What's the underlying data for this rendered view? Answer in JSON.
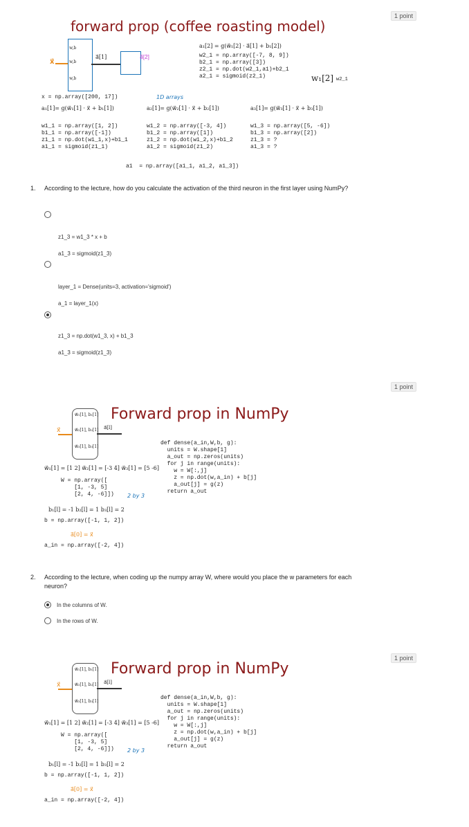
{
  "points": [
    "1 point",
    "1 point",
    "1 point"
  ],
  "slide1": {
    "title": "forward prop (coffee roasting model)",
    "layer2_math": "a₁[2] = g(w⃗₁[2] · a⃗[1] + b₁[2])",
    "layer2_code": [
      "w2_1 = np.array([-7, 8, 9])",
      "b2_1 = np.array([3])",
      "z2_1 = np.dot(w2_1,a1)+b2_1",
      "a2_1 = sigmoid(z2_1)"
    ],
    "w2_label": "w₁[2]",
    "w2_var": "w2_1",
    "x_line": "x = np.array([200, 17])",
    "oned_note": "1D arrays",
    "neuron1_math": "a₁[1]= g(w⃗₁[1] · x⃗ + b₁[1])",
    "neuron2_math": "a₂[1]= g(w⃗₂[1] · x⃗ + b₂[1])",
    "neuron3_math": "a₃[1]= g(w⃗₃[1] · x⃗ + b₃[1])",
    "neuron1_code": [
      "w1_1 = np.array([1, 2])",
      "b1_1 = np.array([-1])",
      "z1_1 = np.dot(w1_1,x)+b1_1",
      "a1_1 = sigmoid(z1_1)"
    ],
    "neuron2_code": [
      "w1_2 = np.array([-3, 4])",
      "b1_2 = np.array([1])",
      "z1_2 = np.dot(w1_2,x)+b1_2",
      "a1_2 = sigmoid(z1_2)"
    ],
    "neuron3_code": [
      "w1_3 = np.array([5, -6])",
      "b1_3 = np.array([2])",
      "z1_3 = ?",
      "a1_3 = ?"
    ],
    "a1_line": "a1  = np.array([a1_1, a1_2, a1_3])",
    "layer1_label": "a⃗[1]",
    "layer2_label": "a⃗[2]",
    "x_input": "x⃗"
  },
  "q1": {
    "number": "1.",
    "text": "According to the lecture, how do you calculate the activation of the third neuron in the first layer using NumPy?",
    "options": [
      {
        "lines": [
          "z1_3 = w1_3 * x + b",
          "a1_3 = sigmoid(z1_3)"
        ],
        "selected": false
      },
      {
        "lines": [
          "layer_1 = Dense(units=3, activation='sigmoid')",
          "a_1 = layer_1(x)"
        ],
        "selected": false
      },
      {
        "lines": [
          "z1_3 = np.dot(w1_3, x) + b1_3",
          "a1_3 = sigmoid(z1_3)"
        ],
        "selected": true
      }
    ]
  },
  "slide2": {
    "title": "Forward prop in NumPy",
    "w_vectors": "w⃗₁[1] = [1 2]   w⃗₂[1] = [-3 4]   w⃗₃[1] = [5 -6]",
    "w_code": [
      "W = np.array([",
      "    [1, -3, 5]",
      "    [2, 4, -6]])"
    ],
    "by_note": "2 by 3",
    "b_math": "b₁[l] = -1   b₂[l] = 1   b₃[l] = 2",
    "b_code": "b = np.array([-1, 1, 2])",
    "a0_math": "a⃗[0] = x⃗",
    "ain_code": "a_in = np.array([-2, 4])",
    "dense_code": [
      "def dense(a_in,W,b, g):",
      "  units = W.shape[1]",
      "  a_out = np.zeros(units)",
      "  for j in range(units):",
      "    w = W[:,j]",
      "    z = np.dot(w,a_in) + b[j]",
      "    a_out[j] = g(z)",
      "  return a_out"
    ],
    "neuron_labels": [
      "w⃗₁[1], b₁[1]",
      "w⃗₂[1], b₂[1]",
      "w⃗₃[1], b₃[1]"
    ],
    "layer_label": "a⃗[l]",
    "x_input": "x⃗"
  },
  "q2": {
    "number": "2.",
    "text": "According to the lecture, when coding up the numpy array W, where would you place the w parameters for each neuron?",
    "options": [
      {
        "label": "In the columns of W.",
        "selected": true
      },
      {
        "label": "In the rows of W.",
        "selected": false
      }
    ]
  }
}
